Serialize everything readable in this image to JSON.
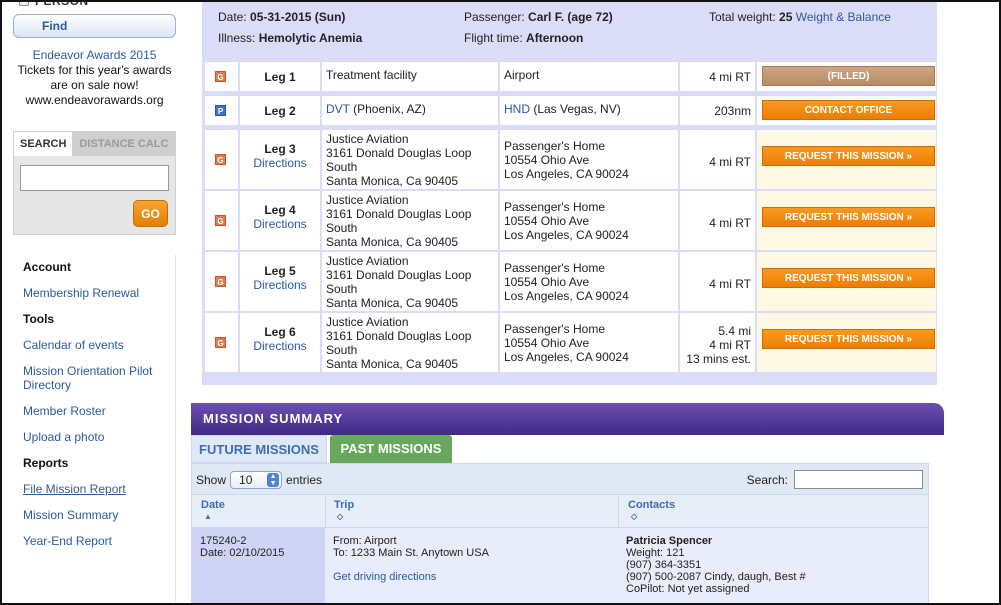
{
  "sidebar": {
    "person_header": "PERSON",
    "find_label": "Find",
    "awards": {
      "line1": "Endeavor Awards 2015",
      "line2": "Tickets for this year's awards",
      "line3": "are on sale now!",
      "line4": "www.endeavorawards.org"
    },
    "search": {
      "tab_search": "SEARCH",
      "tab_distance": "DISTANCE CALC",
      "input_value": "",
      "go_label": "GO"
    },
    "nav": {
      "account_head": "Account",
      "membership_renewal": "Membership Renewal",
      "tools_head": "Tools",
      "calendar": "Calendar of events",
      "mission_orientation_1": "Mission Orientation Pilot",
      "mission_orientation_2": "Directory",
      "member_roster": "Member Roster",
      "upload_photo": "Upload a photo",
      "reports_head": "Reports",
      "file_mission_report": "File Mission Report",
      "mission_summary": "Mission Summary",
      "year_end_report": "Year-End Report"
    }
  },
  "trip": {
    "date_label": "Date:",
    "date_value": "05-31-2015 (Sun)",
    "illness_label": "Illness:",
    "illness_value": "Hemolytic Anemia",
    "passenger_label": "Passenger:",
    "passenger_value": "Carl F. (age 72)",
    "flight_time_label": "Flight time:",
    "flight_time_value": "Afternoon",
    "weight_label": "Total weight:",
    "weight_value": "25",
    "weight_link": "Weight & Balance"
  },
  "legs": [
    {
      "badge": "G",
      "name": "Leg 1",
      "directions": "",
      "from": [
        "Treatment facility"
      ],
      "from_link": "",
      "to": [
        "Airport"
      ],
      "to_link": "",
      "dist": [
        "4 mi RT"
      ],
      "action": "(FILLED)"
    },
    {
      "badge": "P",
      "name": "Leg 2",
      "directions": "",
      "from_link": "DVT",
      "from": [
        " (Phoenix, AZ)"
      ],
      "to_link": "HND",
      "to": [
        " (Las Vegas, NV)"
      ],
      "dist": [
        "203nm"
      ],
      "action": "CONTACT OFFICE"
    },
    {
      "badge": "G",
      "name": "Leg 3",
      "directions": "Directions",
      "from": [
        "Justice Aviation",
        "3161 Donald Douglas Loop",
        "South",
        "Santa Monica, Ca 90405"
      ],
      "to": [
        "Passenger's Home",
        "10554 Ohio Ave",
        "Los Angeles, CA 90024"
      ],
      "dist": [
        "4 mi RT"
      ],
      "action": "REQUEST THIS MISSION »"
    },
    {
      "badge": "G",
      "name": "Leg 4",
      "directions": "Directions",
      "from": [
        "Justice Aviation",
        "3161 Donald Douglas Loop",
        "South",
        "Santa Monica, Ca 90405"
      ],
      "to": [
        "Passenger's Home",
        "10554 Ohio Ave",
        "Los Angeles, CA 90024"
      ],
      "dist": [
        "4 mi RT"
      ],
      "action": "REQUEST THIS MISSION »"
    },
    {
      "badge": "G",
      "name": "Leg 5",
      "directions": "Directions",
      "from": [
        "Justice Aviation",
        "3161 Donald Douglas Loop",
        "South",
        "Santa Monica, Ca 90405"
      ],
      "to": [
        "Passenger's Home",
        "10554 Ohio Ave",
        "Los Angeles, CA 90024"
      ],
      "dist": [
        "4 mi RT"
      ],
      "action": "REQUEST THIS MISSION »"
    },
    {
      "badge": "G",
      "name": "Leg 6",
      "directions": "Directions",
      "from": [
        "Justice Aviation",
        "3161 Donald Douglas Loop",
        "South",
        "Santa Monica, Ca 90405"
      ],
      "to": [
        "Passenger's Home",
        "10554 Ohio Ave",
        "Los Angeles, CA 90024"
      ],
      "dist": [
        "5.4 mi",
        "4 mi RT",
        "13 mins est."
      ],
      "action": "REQUEST THIS MISSION »"
    }
  ],
  "summary": {
    "title": "MISSION SUMMARY",
    "tab_future": "FUTURE MISSIONS",
    "tab_past": "PAST MISSIONS",
    "show_label": "Show",
    "entries_value": "10",
    "entries_label": "entries",
    "search_label": "Search:",
    "search_value": "",
    "col_date": "Date",
    "col_trip": "Trip",
    "col_contacts": "Contacts",
    "row": {
      "id": "175240-2",
      "date": "Date: 02/10/2015",
      "from": "From: Airport",
      "to": "To: 1233 Main St. Anytown USA",
      "directions": "Get driving directions",
      "contact_name": "Patricia Spencer",
      "weight": "Weight: 121",
      "phone1": "(907) 364-3351",
      "phone2": "(907) 500-2087 Cindy, daugh, Best #",
      "copilot": "CoPilot: Not yet assigned"
    }
  },
  "colors": {
    "panel_bg": "#dadcf8",
    "link": "#2a5aa0",
    "orange_button": "#ec7d06",
    "summary_bar": "#4e3596",
    "past_tab": "#67a85c"
  }
}
